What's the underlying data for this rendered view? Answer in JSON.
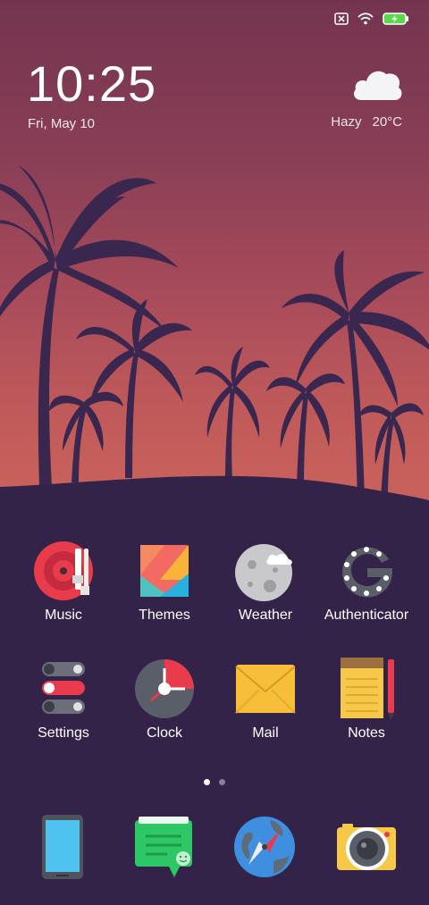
{
  "status_bar": {
    "icons": [
      "sim-error-icon",
      "wifi-icon",
      "battery-charging-icon"
    ]
  },
  "lockclock": {
    "time": "10:25",
    "date": "Fri, May 10"
  },
  "weather_widget": {
    "icon": "cloud-icon",
    "condition": "Hazy",
    "temperature": "20°C"
  },
  "home_apps": [
    {
      "label": "Music",
      "icon": "music-icon"
    },
    {
      "label": "Themes",
      "icon": "themes-icon"
    },
    {
      "label": "Weather",
      "icon": "weather-icon"
    },
    {
      "label": "Authenticator",
      "icon": "authenticator-icon"
    },
    {
      "label": "Settings",
      "icon": "settings-icon"
    },
    {
      "label": "Clock",
      "icon": "clock-icon"
    },
    {
      "label": "Mail",
      "icon": "mail-icon"
    },
    {
      "label": "Notes",
      "icon": "notes-icon"
    }
  ],
  "page_indicator": {
    "pages": 2,
    "current": 1
  },
  "dock": [
    {
      "icon": "phone-icon"
    },
    {
      "icon": "messaging-icon"
    },
    {
      "icon": "browser-icon"
    },
    {
      "icon": "camera-icon"
    }
  ],
  "colors": {
    "sky_top": "#74344f",
    "sky_bottom": "#c8615b",
    "silhouette": "#35244e",
    "ground": "#332349"
  }
}
